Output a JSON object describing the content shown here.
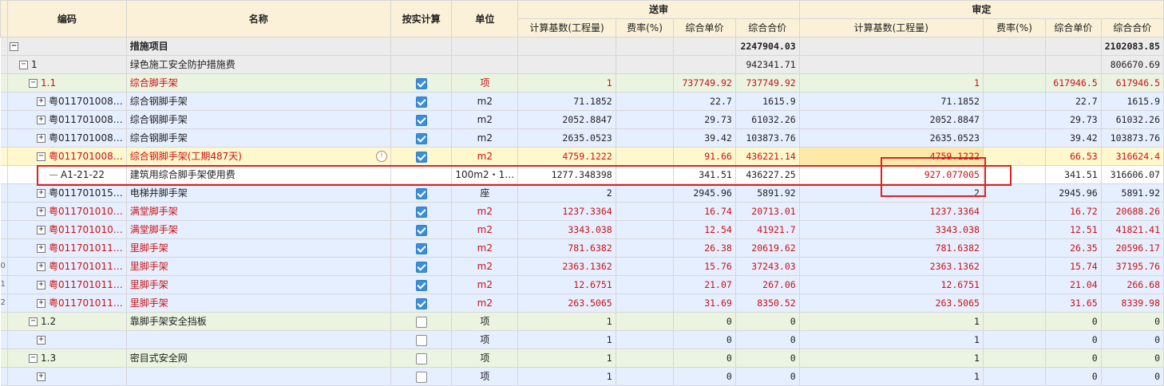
{
  "header": {
    "code": "编码",
    "name": "名称",
    "actual": "按实计算",
    "unit": "单位",
    "group_submit": "送审",
    "group_audit": "审定",
    "base": "计算基数(工程量)",
    "rate": "费率(%)",
    "price": "综合单价",
    "total": "综合合价"
  },
  "rows": [
    {
      "ln": "",
      "code": "",
      "tog": "−",
      "name": "措施项目",
      "chk": null,
      "unit": "",
      "s_base": "",
      "s_rate": "",
      "s_price": "",
      "s_total": "2247904.03",
      "a_base": "",
      "a_rate": "",
      "a_price": "",
      "a_total": "2102083.85",
      "cls": "l0",
      "red": false,
      "bold": true
    },
    {
      "ln": "",
      "code": "1",
      "tog": "−",
      "name": "绿色施工安全防护措施费",
      "chk": null,
      "unit": "",
      "s_base": "",
      "s_rate": "",
      "s_price": "",
      "s_total": "942341.71",
      "a_base": "",
      "a_rate": "",
      "a_price": "",
      "a_total": "806670.69",
      "cls": "l1",
      "red": false,
      "bold": false
    },
    {
      "ln": "",
      "code": "1.1",
      "tog": "−",
      "name": "综合脚手架",
      "chk": true,
      "unit": "项",
      "s_base": "1",
      "s_rate": "",
      "s_price": "737749.92",
      "s_total": "737749.92",
      "a_base": "1",
      "a_rate": "",
      "a_price": "617946.5",
      "a_total": "617946.5",
      "cls": "l2",
      "red": true,
      "bold": false
    },
    {
      "ln": "",
      "code": "粤011701008…",
      "tog": "+",
      "name": "综合钢脚手架",
      "chk": true,
      "unit": "m2",
      "s_base": "71.1852",
      "s_rate": "",
      "s_price": "22.7",
      "s_total": "1615.9",
      "a_base": "71.1852",
      "a_rate": "",
      "a_price": "22.7",
      "a_total": "1615.9",
      "cls": "l3",
      "red": false,
      "bold": false
    },
    {
      "ln": "",
      "code": "粤011701008…",
      "tog": "+",
      "name": "综合钢脚手架",
      "chk": true,
      "unit": "m2",
      "s_base": "2052.8847",
      "s_rate": "",
      "s_price": "29.73",
      "s_total": "61032.26",
      "a_base": "2052.8847",
      "a_rate": "",
      "a_price": "29.73",
      "a_total": "61032.26",
      "cls": "l3",
      "red": false,
      "bold": false
    },
    {
      "ln": "",
      "code": "粤011701008…",
      "tog": "+",
      "name": "综合钢脚手架",
      "chk": true,
      "unit": "m2",
      "s_base": "2635.0523",
      "s_rate": "",
      "s_price": "39.42",
      "s_total": "103873.76",
      "a_base": "2635.0523",
      "a_rate": "",
      "a_price": "39.42",
      "a_total": "103873.76",
      "cls": "l3",
      "red": false,
      "bold": false
    },
    {
      "ln": "",
      "code": "粤011701008…",
      "tog": "−",
      "name": "综合钢脚手架(工期487天)",
      "chk": true,
      "unit": "m2",
      "s_base": "4759.1222",
      "s_rate": "",
      "s_price": "91.66",
      "s_total": "436221.14",
      "a_base": "4759.1222",
      "a_rate": "",
      "a_price": "66.53",
      "a_total": "316624.4",
      "cls": "sel",
      "red": true,
      "bold": false,
      "warn": "!"
    },
    {
      "ln": "",
      "code": "A1-21-22",
      "tog": "",
      "name": "建筑用综合脚手架使用费",
      "chk": null,
      "unit": "100m2・1…",
      "s_base": "1277.348398",
      "s_rate": "",
      "s_price": "341.51",
      "s_total": "436227.25",
      "a_base": "927.077005",
      "a_rate": "",
      "a_price": "341.51",
      "a_total": "316606.07",
      "cls": "sub",
      "red": false,
      "bold": false
    },
    {
      "ln": "",
      "code": "粤011701015…",
      "tog": "+",
      "name": "电梯井脚手架",
      "chk": true,
      "unit": "座",
      "s_base": "2",
      "s_rate": "",
      "s_price": "2945.96",
      "s_total": "5891.92",
      "a_base": "2",
      "a_rate": "",
      "a_price": "2945.96",
      "a_total": "5891.92",
      "cls": "l3",
      "red": false,
      "bold": false
    },
    {
      "ln": "",
      "code": "粤011701010…",
      "tog": "+",
      "name": "满堂脚手架",
      "chk": true,
      "unit": "m2",
      "s_base": "1237.3364",
      "s_rate": "",
      "s_price": "16.74",
      "s_total": "20713.01",
      "a_base": "1237.3364",
      "a_rate": "",
      "a_price": "16.72",
      "a_total": "20688.26",
      "cls": "l3",
      "red": true,
      "bold": false
    },
    {
      "ln": "",
      "code": "粤011701010…",
      "tog": "+",
      "name": "满堂脚手架",
      "chk": true,
      "unit": "m2",
      "s_base": "3343.038",
      "s_rate": "",
      "s_price": "12.54",
      "s_total": "41921.7",
      "a_base": "3343.038",
      "a_rate": "",
      "a_price": "12.51",
      "a_total": "41821.41",
      "cls": "l3",
      "red": true,
      "bold": false
    },
    {
      "ln": "",
      "code": "粤011701011…",
      "tog": "+",
      "name": "里脚手架",
      "chk": true,
      "unit": "m2",
      "s_base": "781.6382",
      "s_rate": "",
      "s_price": "26.38",
      "s_total": "20619.62",
      "a_base": "781.6382",
      "a_rate": "",
      "a_price": "26.35",
      "a_total": "20596.17",
      "cls": "l3",
      "red": true,
      "bold": false
    },
    {
      "ln": "0",
      "code": "粤011701011…",
      "tog": "+",
      "name": "里脚手架",
      "chk": true,
      "unit": "m2",
      "s_base": "2363.1362",
      "s_rate": "",
      "s_price": "15.76",
      "s_total": "37243.03",
      "a_base": "2363.1362",
      "a_rate": "",
      "a_price": "15.74",
      "a_total": "37195.76",
      "cls": "l3",
      "red": true,
      "bold": false
    },
    {
      "ln": "1",
      "code": "粤011701011…",
      "tog": "+",
      "name": "里脚手架",
      "chk": true,
      "unit": "m2",
      "s_base": "12.6751",
      "s_rate": "",
      "s_price": "21.07",
      "s_total": "267.06",
      "a_base": "12.6751",
      "a_rate": "",
      "a_price": "21.04",
      "a_total": "266.68",
      "cls": "l3",
      "red": true,
      "bold": false
    },
    {
      "ln": "2",
      "code": "粤011701011…",
      "tog": "+",
      "name": "里脚手架",
      "chk": true,
      "unit": "m2",
      "s_base": "263.5065",
      "s_rate": "",
      "s_price": "31.69",
      "s_total": "8350.52",
      "a_base": "263.5065",
      "a_rate": "",
      "a_price": "31.65",
      "a_total": "8339.98",
      "cls": "l3",
      "red": true,
      "bold": false
    },
    {
      "ln": "",
      "code": "1.2",
      "tog": "−",
      "name": "靠脚手架安全挡板",
      "chk": false,
      "unit": "项",
      "s_base": "1",
      "s_rate": "",
      "s_price": "0",
      "s_total": "0",
      "a_base": "1",
      "a_rate": "",
      "a_price": "0",
      "a_total": "0",
      "cls": "l2",
      "red": false,
      "bold": false
    },
    {
      "ln": "",
      "code": "",
      "tog": "+",
      "name": "",
      "chk": false,
      "unit": "项",
      "s_base": "1",
      "s_rate": "",
      "s_price": "0",
      "s_total": "0",
      "a_base": "1",
      "a_rate": "",
      "a_price": "0",
      "a_total": "0",
      "cls": "l3",
      "red": false,
      "bold": false
    },
    {
      "ln": "",
      "code": "1.3",
      "tog": "−",
      "name": "密目式安全网",
      "chk": false,
      "unit": "项",
      "s_base": "1",
      "s_rate": "",
      "s_price": "0",
      "s_total": "0",
      "a_base": "1",
      "a_rate": "",
      "a_price": "0",
      "a_total": "0",
      "cls": "l2",
      "red": false,
      "bold": false
    },
    {
      "ln": "",
      "code": "",
      "tog": "+",
      "name": "",
      "chk": false,
      "unit": "项",
      "s_base": "1",
      "s_rate": "",
      "s_price": "0",
      "s_total": "0",
      "a_base": "1",
      "a_rate": "",
      "a_price": "0",
      "a_total": "0",
      "cls": "l3",
      "red": false,
      "bold": false
    }
  ],
  "colors": {
    "red_text": "#cc1111",
    "annotation_box": "#e02020",
    "checkbox_on": "#3b8fd8"
  }
}
